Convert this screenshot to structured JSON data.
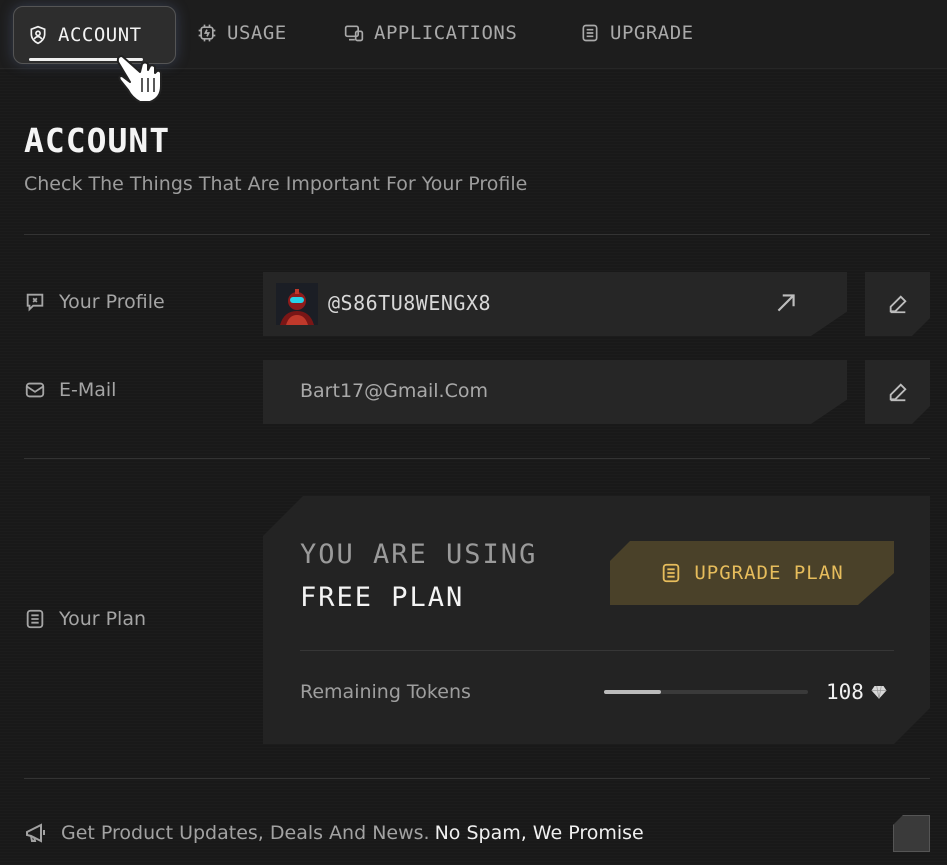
{
  "nav": {
    "tabs": [
      {
        "label": "ACCOUNT",
        "icon": "user-shield-icon",
        "active": true
      },
      {
        "label": "USAGE",
        "icon": "chip-icon",
        "active": false
      },
      {
        "label": "APPLICATIONS",
        "icon": "devices-icon",
        "active": false
      },
      {
        "label": "UPGRADE",
        "icon": "list-icon",
        "active": false
      }
    ]
  },
  "page": {
    "title": "ACCOUNT",
    "subtitle": "Check The Things That Are Important For Your Profile"
  },
  "profile": {
    "label": "Your Profile",
    "handle": "@S86TU8WENGX8"
  },
  "email": {
    "label": "E-Mail",
    "value": "Bart17@Gmail.Com"
  },
  "plan": {
    "label": "Your Plan",
    "line1": "YOU ARE USING",
    "line2": "FREE PLAN",
    "upgrade_label": "UPGRADE PLAN",
    "tokens_label": "Remaining Tokens",
    "tokens_value": "108",
    "tokens_fraction": 0.28
  },
  "footer": {
    "text": "Get Product Updates, Deals And News.",
    "text_strong": "No Spam, We Promise"
  },
  "colors": {
    "background": "#191919",
    "accent_gold": "#e7bd5c",
    "panel": "#262626"
  }
}
